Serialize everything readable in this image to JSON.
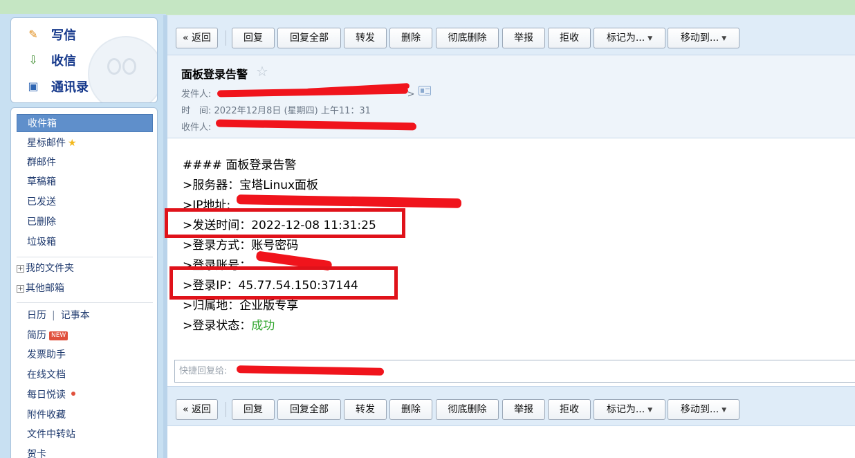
{
  "sidebar": {
    "compose": [
      {
        "label": "写信",
        "icon": "pencil-icon"
      },
      {
        "label": "收信",
        "icon": "inbox-download-icon"
      },
      {
        "label": "通讯录",
        "icon": "contact-card-icon"
      }
    ],
    "folders": {
      "inbox": "收件箱",
      "starred": "星标邮件",
      "group": "群邮件",
      "drafts": "草稿箱",
      "sent": "已发送",
      "deleted": "已删除",
      "trash": "垃圾箱"
    },
    "trees": {
      "my_folders": "我的文件夹",
      "other_mailboxes": "其他邮箱",
      "expander": "+"
    },
    "apps": {
      "calendar": "日历",
      "divider": "|",
      "notebook": "记事本",
      "resume": "简历",
      "resume_badge": "NEW",
      "invoice": "发票助手",
      "docs": "在线文档",
      "daily_read": "每日悦读",
      "attachments": "附件收藏",
      "file_transfer": "文件中转站",
      "greeting_card": "贺卡"
    }
  },
  "toolbar": {
    "back": "« 返回",
    "reply": "回复",
    "reply_all": "回复全部",
    "forward": "转发",
    "delete": "删除",
    "delete_forever": "彻底删除",
    "report": "举报",
    "reject": "拒收",
    "mark_as": "标记为...",
    "move_to": "移动到...",
    "caret": "▼"
  },
  "mail": {
    "subject": "面板登录告警",
    "star": "☆",
    "from_label": "发件人:",
    "from_tail": ">",
    "time_label": "时　间:",
    "time_value": "2022年12月8日 (星期四) 上午11：31",
    "to_label": "收件人:",
    "body": {
      "heading": "#### 面板登录告警",
      "server": ">服务器：宝塔Linux面板",
      "ip": ">IP地址:",
      "send_time": ">发送时间：2022-12-08 11:31:25",
      "login_method": ">登录方式：账号密码",
      "login_account": ">登录账号：",
      "login_ip": ">登录IP：45.77.54.150:37144",
      "location": ">归属地：企业版专享",
      "status_label": ">登录状态：",
      "status_value": "成功"
    },
    "quick_reply_placeholder": "快捷回复给:"
  },
  "colors": {
    "redaction": "#f0141c",
    "highlight_box": "#e0121a",
    "success": "#2fa52c",
    "link": "#1f3a6e"
  }
}
